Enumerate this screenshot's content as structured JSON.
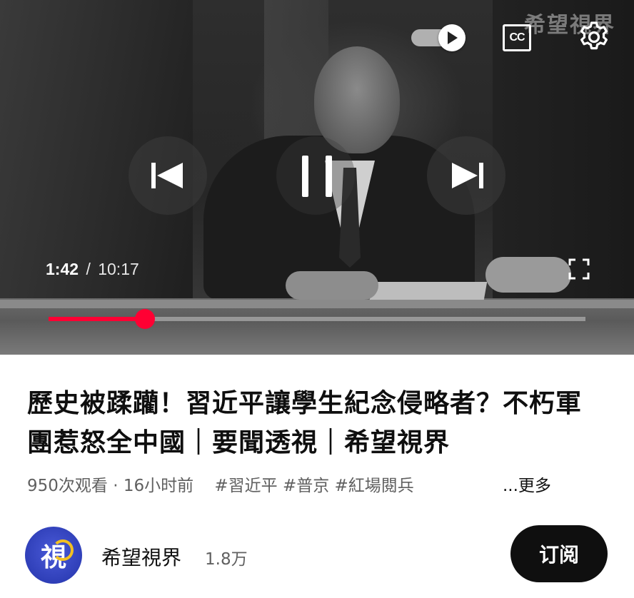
{
  "player": {
    "watermark": "希望視界",
    "cc_label": "CC",
    "current_time": "1:42",
    "time_separator": "/",
    "duration": "10:17",
    "progress_fraction": 0.18,
    "autoplay_on": true,
    "icons": {
      "previous": "skip-previous-icon",
      "pause": "pause-icon",
      "next": "skip-next-icon",
      "autoplay": "autoplay-toggle-icon",
      "captions": "closed-captions-icon",
      "settings": "gear-icon",
      "fullscreen": "fullscreen-icon"
    },
    "accent_color": "#ff0033"
  },
  "video": {
    "title": "歷史被蹂躪！習近平讓學生紀念侵略者？不朽軍團惹怒全中國｜要聞透視｜希望視界",
    "views": "950次观看",
    "meta_separator": "·",
    "uploaded": "16小时前",
    "hashtags": "#習近平 #普京 #紅場閱兵",
    "more_label": "...更多"
  },
  "channel": {
    "avatar_glyph": "視",
    "name": "希望視界",
    "subscribers": "1.8万",
    "subscribe_label": "订阅"
  }
}
